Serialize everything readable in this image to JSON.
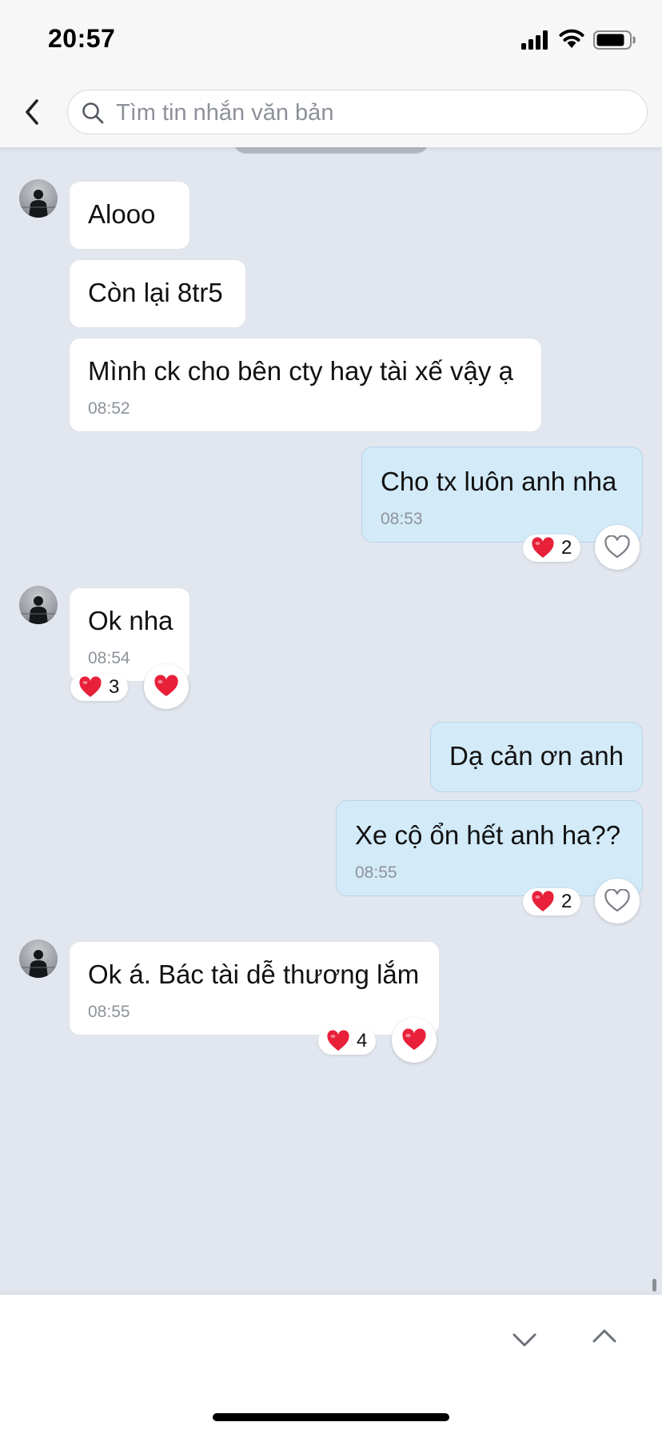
{
  "status_bar": {
    "time": "20:57"
  },
  "search": {
    "placeholder": "Tìm tin nhắn văn bản",
    "value": ""
  },
  "colors": {
    "outgoing_bubble": "#d3eaf8",
    "incoming_bubble": "#ffffff",
    "heart": "#e8203a",
    "background": "#e2e6ef"
  },
  "icons": [
    "back-chevron-icon",
    "search-icon",
    "heart-icon",
    "heart-outline-icon",
    "chevron-down-icon",
    "chevron-up-icon"
  ],
  "messages": [
    {
      "direction": "incoming",
      "text": "Alooo"
    },
    {
      "direction": "incoming",
      "text": "Còn lại 8tr5"
    },
    {
      "direction": "incoming",
      "text": "Mình ck cho bên cty hay tài xế vậy ạ",
      "time": "08:52"
    },
    {
      "direction": "outgoing",
      "text": "Cho tx luôn anh nha",
      "time": "08:53",
      "reaction_count": "2",
      "my_reaction": "none"
    },
    {
      "direction": "incoming",
      "text": "Ok nha",
      "time": "08:54",
      "reaction_count": "3",
      "my_reaction": "heart"
    },
    {
      "direction": "outgoing",
      "text": "Dạ cản ơn anh"
    },
    {
      "direction": "outgoing",
      "text": "Xe cộ ổn hết anh ha??",
      "time": "08:55",
      "reaction_count": "2",
      "my_reaction": "none"
    },
    {
      "direction": "incoming",
      "text": "Ok á. Bác tài dễ thương lắm",
      "time": "08:55",
      "reaction_count": "4",
      "my_reaction": "heart"
    }
  ]
}
